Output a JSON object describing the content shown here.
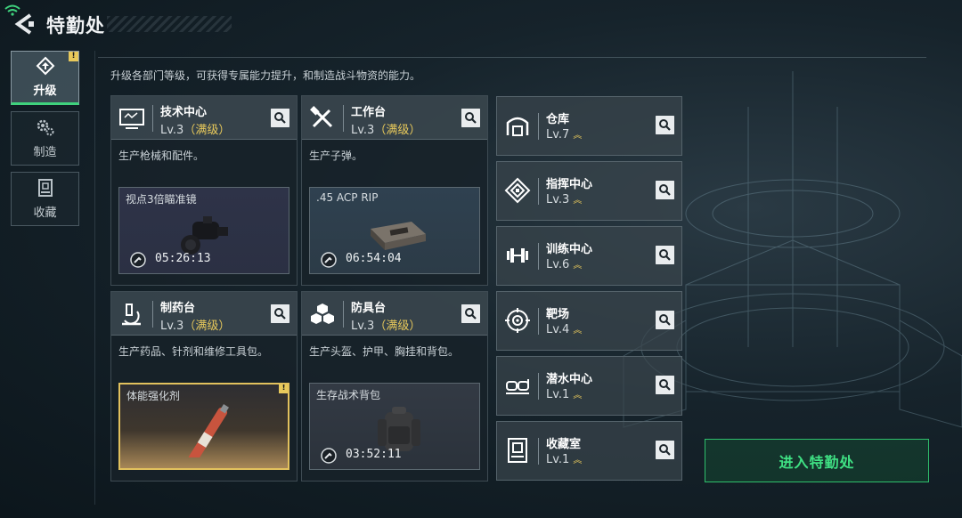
{
  "header": {
    "title": "特勤处"
  },
  "nav": [
    {
      "label": "升级",
      "alert": "!"
    },
    {
      "label": "制造"
    },
    {
      "label": "收藏"
    }
  ],
  "description": "升级各部门等级，可获得专属能力提升，和制造战斗物资的能力。",
  "departments": [
    {
      "name": "技术中心",
      "level": "Lv.3",
      "max_label": "（满级）",
      "desc": "生产枪械和配件。",
      "product": {
        "name": "视点3倍瞄准镜",
        "timer": "05:26:13"
      }
    },
    {
      "name": "工作台",
      "level": "Lv.3",
      "max_label": "（满级）",
      "desc": "生产子弹。",
      "product": {
        "name": ".45 ACP RIP",
        "timer": "06:54:04"
      }
    },
    {
      "name": "制药台",
      "level": "Lv.3",
      "max_label": "（满级）",
      "desc": "生产药品、针剂和维修工具包。",
      "product": {
        "name": "体能强化剂",
        "alert": "!"
      }
    },
    {
      "name": "防具台",
      "level": "Lv.3",
      "max_label": "（满级）",
      "desc": "生产头盔、护甲、胸挂和背包。",
      "product": {
        "name": "生存战术背包",
        "timer": "03:52:11"
      }
    }
  ],
  "facilities": [
    {
      "name": "仓库",
      "level": "Lv.7",
      "icon": "warehouse-icon"
    },
    {
      "name": "指挥中心",
      "level": "Lv.3",
      "icon": "command-icon"
    },
    {
      "name": "训练中心",
      "level": "Lv.6",
      "icon": "dumbbell-icon"
    },
    {
      "name": "靶场",
      "level": "Lv.4",
      "icon": "target-icon"
    },
    {
      "name": "潜水中心",
      "level": "Lv.1",
      "icon": "diving-mask-icon"
    },
    {
      "name": "收藏室",
      "level": "Lv.1",
      "icon": "collection-icon"
    }
  ],
  "enter_button": "进入特勤处",
  "colors": {
    "accent_green": "#3fd27d",
    "max_gold": "#e8c95b"
  }
}
